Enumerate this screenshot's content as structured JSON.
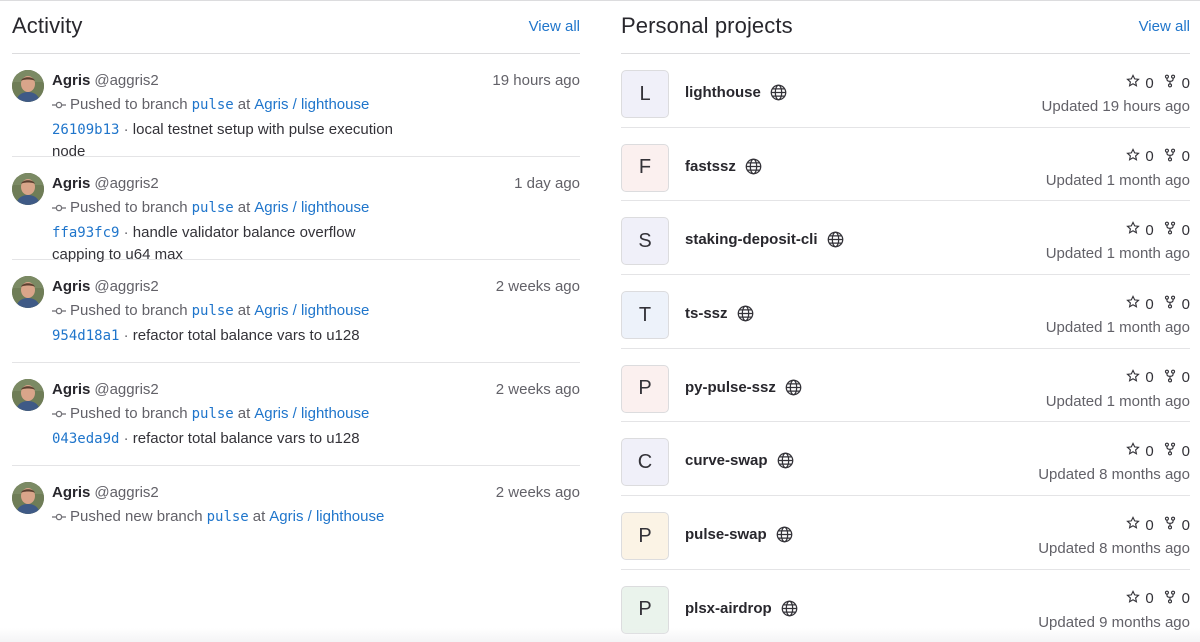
{
  "activity": {
    "title": "Activity",
    "view_all": "View all",
    "events": [
      {
        "author": "Agris",
        "handle": "@aggris2",
        "time": "19 hours ago",
        "action": "Pushed to branch",
        "branch": "pulse",
        "at": "at",
        "repo": "Agris / lighthouse",
        "sha": "26109b13",
        "sep": "·",
        "message": "local testnet setup with pulse execution node"
      },
      {
        "author": "Agris",
        "handle": "@aggris2",
        "time": "1 day ago",
        "action": "Pushed to branch",
        "branch": "pulse",
        "at": "at",
        "repo": "Agris / lighthouse",
        "sha": "ffa93fc9",
        "sep": "·",
        "message": "handle validator balance overflow capping to u64 max"
      },
      {
        "author": "Agris",
        "handle": "@aggris2",
        "time": "2 weeks ago",
        "action": "Pushed to branch",
        "branch": "pulse",
        "at": "at",
        "repo": "Agris / lighthouse",
        "sha": "954d18a1",
        "sep": "·",
        "message": "refactor total balance vars to u128"
      },
      {
        "author": "Agris",
        "handle": "@aggris2",
        "time": "2 weeks ago",
        "action": "Pushed to branch",
        "branch": "pulse",
        "at": "at",
        "repo": "Agris / lighthouse",
        "sha": "043eda9d",
        "sep": "·",
        "message": "refactor total balance vars to u128"
      },
      {
        "author": "Agris",
        "handle": "@aggris2",
        "time": "2 weeks ago",
        "action": "Pushed new branch",
        "branch": "pulse",
        "at": "at",
        "repo": "Agris / lighthouse"
      }
    ]
  },
  "projects": {
    "title": "Personal projects",
    "view_all": "View all",
    "items": [
      {
        "initial": "L",
        "name": "lighthouse",
        "stars": "0",
        "forks": "0",
        "updated": "Updated 19 hours ago",
        "color": "#f0f0f9"
      },
      {
        "initial": "F",
        "name": "fastssz",
        "stars": "0",
        "forks": "0",
        "updated": "Updated 1 month ago",
        "color": "#fbf0ef"
      },
      {
        "initial": "S",
        "name": "staking-deposit-cli",
        "stars": "0",
        "forks": "0",
        "updated": "Updated 1 month ago",
        "color": "#f0f0f9"
      },
      {
        "initial": "T",
        "name": "ts-ssz",
        "stars": "0",
        "forks": "0",
        "updated": "Updated 1 month ago",
        "color": "#edf2fa"
      },
      {
        "initial": "P",
        "name": "py-pulse-ssz",
        "stars": "0",
        "forks": "0",
        "updated": "Updated 1 month ago",
        "color": "#fbf0ef"
      },
      {
        "initial": "C",
        "name": "curve-swap",
        "stars": "0",
        "forks": "0",
        "updated": "Updated 8 months ago",
        "color": "#f0f0f9"
      },
      {
        "initial": "P",
        "name": "pulse-swap",
        "stars": "0",
        "forks": "0",
        "updated": "Updated 8 months ago",
        "color": "#fbf3e5"
      },
      {
        "initial": "P",
        "name": "plsx-airdrop",
        "stars": "0",
        "forks": "0",
        "updated": "Updated 9 months ago",
        "color": "#eaf3ec"
      }
    ]
  },
  "icons": {
    "commit": "commit-icon",
    "globe": "globe-icon",
    "star": "star-icon",
    "fork": "fork-icon"
  },
  "colors": {
    "link": "#1f75cb",
    "muted": "#626168",
    "border": "#dcdcde"
  }
}
